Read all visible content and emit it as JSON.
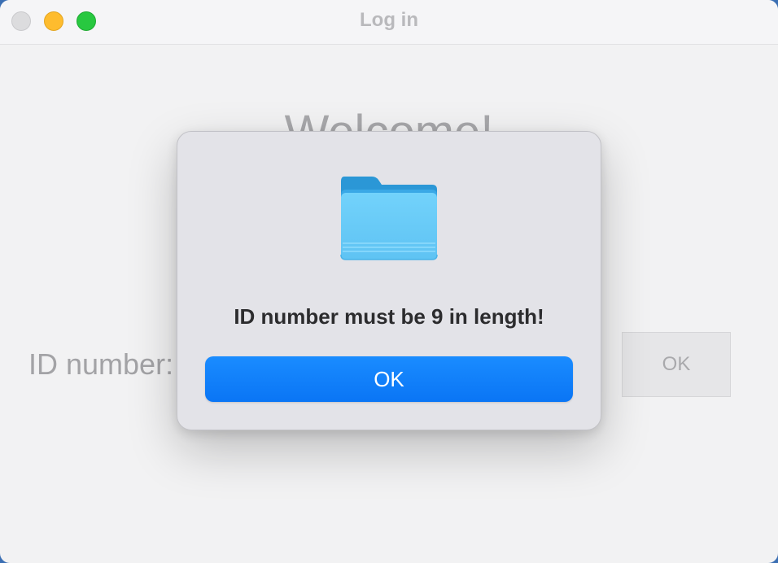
{
  "window": {
    "title": "Log in"
  },
  "background": {
    "welcome": "Welcome!",
    "id_label": "ID number:",
    "ok_label": "OK"
  },
  "alert": {
    "icon": "folder-icon",
    "message": "ID number must be 9 in length!",
    "ok_label": "OK"
  },
  "colors": {
    "accent": "#0a7aff",
    "folder": "#6ecdf8"
  }
}
